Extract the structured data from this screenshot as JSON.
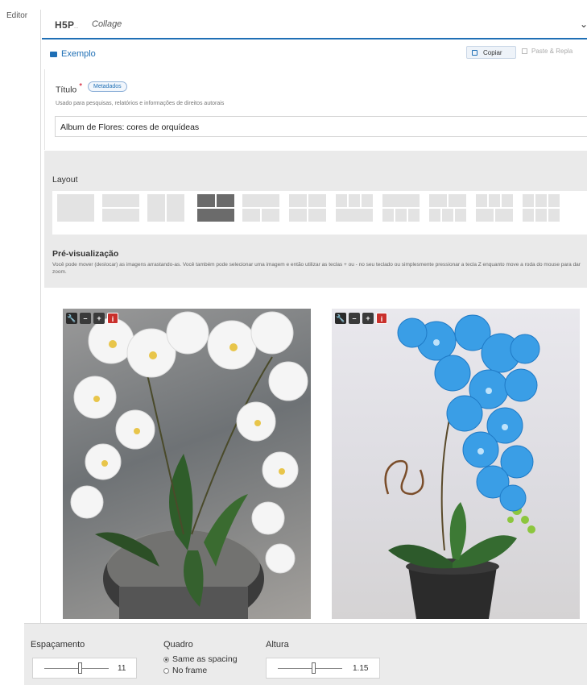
{
  "sidebar": {
    "editor_label": "Editor"
  },
  "library": {
    "logo_main": "H5P",
    "logo_sub": "...",
    "name": "Collage"
  },
  "example": {
    "label": "Exemplo"
  },
  "actions": {
    "copy_label": "Copiar",
    "paste_label": "Paste & Repla"
  },
  "title_field": {
    "label": "Título",
    "required_mark": "*",
    "metadata_button": "Metadados",
    "description": "Usado para pesquisas, relatórios e informações de direitos autorais",
    "value": "Album de Flores: cores de orquídeas"
  },
  "layout": {
    "label": "Layout",
    "selected_index": 3
  },
  "preview": {
    "label": "Pré-visualização",
    "description": "Você pode mover (deslocar) as imagens arrastando-as. Você também pode selecionar uma imagem e então utilizar as teclas + ou - no seu teclado ou simplesmente pressionar a tecla Z enquanto move a roda do mouse para dar zoom."
  },
  "image_tools": {
    "wrench": "🔧",
    "minus": "–",
    "plus": "+",
    "info": "i"
  },
  "options": {
    "spacing": {
      "label": "Espaçamento",
      "value": "11",
      "position": 0.55
    },
    "frame": {
      "label": "Quadro",
      "options": [
        "Same as spacing",
        "No frame"
      ],
      "selected": 0
    },
    "height": {
      "label": "Altura",
      "value": "1.15",
      "position": 0.55
    }
  },
  "colors": {
    "accent": "#1f6fb5",
    "required": "#d0021b",
    "info_button": "#c9302c"
  }
}
